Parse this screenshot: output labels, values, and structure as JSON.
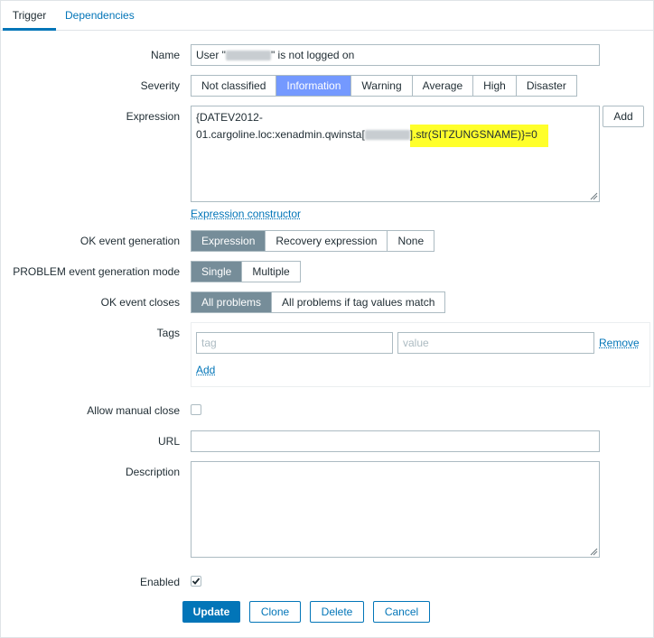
{
  "tabs": {
    "trigger": "Trigger",
    "dependencies": "Dependencies"
  },
  "name": {
    "label": "Name",
    "prefix": "User \"",
    "suffix": "\" is not logged on"
  },
  "severity": {
    "label": "Severity",
    "options": [
      "Not classified",
      "Information",
      "Warning",
      "Average",
      "High",
      "Disaster"
    ],
    "selected": "Information"
  },
  "expression": {
    "label": "Expression",
    "line1": "{DATEV2012-",
    "line2_prefix": "01.cargoline.loc:xenadmin.qwinsta[",
    "line2_highlight": "].str(SITZUNGSNAME)}=0",
    "add_button": "Add",
    "constructor_link": "Expression constructor"
  },
  "ok_event_generation": {
    "label": "OK event generation",
    "options": [
      "Expression",
      "Recovery expression",
      "None"
    ],
    "selected": "Expression"
  },
  "problem_mode": {
    "label": "PROBLEM event generation mode",
    "options": [
      "Single",
      "Multiple"
    ],
    "selected": "Single"
  },
  "ok_event_closes": {
    "label": "OK event closes",
    "options": [
      "All problems",
      "All problems if tag values match"
    ],
    "selected": "All problems"
  },
  "tags": {
    "label": "Tags",
    "tag_placeholder": "tag",
    "value_placeholder": "value",
    "remove_link": "Remove",
    "add_link": "Add"
  },
  "allow_manual_close": {
    "label": "Allow manual close",
    "checked": false
  },
  "url": {
    "label": "URL",
    "value": ""
  },
  "description": {
    "label": "Description",
    "value": ""
  },
  "enabled": {
    "label": "Enabled",
    "checked": true
  },
  "actions": {
    "update": "Update",
    "clone": "Clone",
    "delete": "Delete",
    "cancel": "Cancel"
  },
  "colors": {
    "primary": "#0275b8",
    "selected_gray": "#768d99",
    "selected_severity": "#7499ff",
    "highlight": "#ffff2b"
  }
}
